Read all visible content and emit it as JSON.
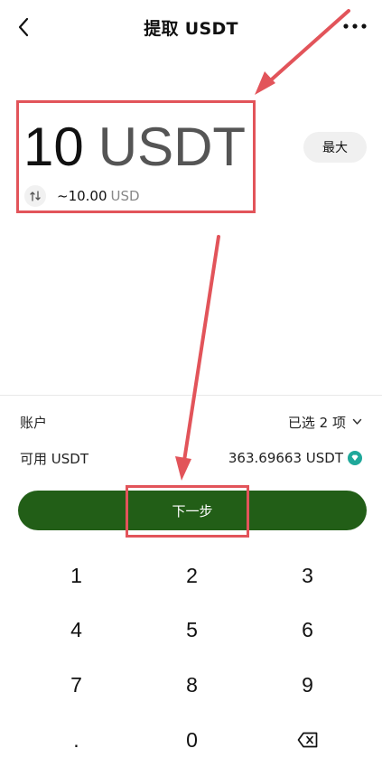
{
  "header": {
    "title": "提取 USDT",
    "back_icon": "chevron-left-icon",
    "more_icon": "more-horizontal-icon"
  },
  "amount": {
    "value": "10",
    "unit": "USDT",
    "fiat_value": "~10.00",
    "fiat_unit": "USD",
    "swap_icon": "swap-arrows-icon"
  },
  "max_label": "最大",
  "account": {
    "label": "账户",
    "selected": "已选 2 项"
  },
  "available": {
    "label": "可用 USDT",
    "value": "363.69663 USDT",
    "badge_icon": "verified-diamond-icon"
  },
  "next_label": "下一步",
  "keypad": {
    "keys": [
      "1",
      "2",
      "3",
      "4",
      "5",
      "6",
      "7",
      "8",
      "9",
      ".",
      "0"
    ],
    "backspace_icon": "backspace-icon"
  },
  "colors": {
    "accent_green": "#225e17",
    "highlight_red": "#e2545a",
    "badge_teal": "#1fa89a"
  }
}
